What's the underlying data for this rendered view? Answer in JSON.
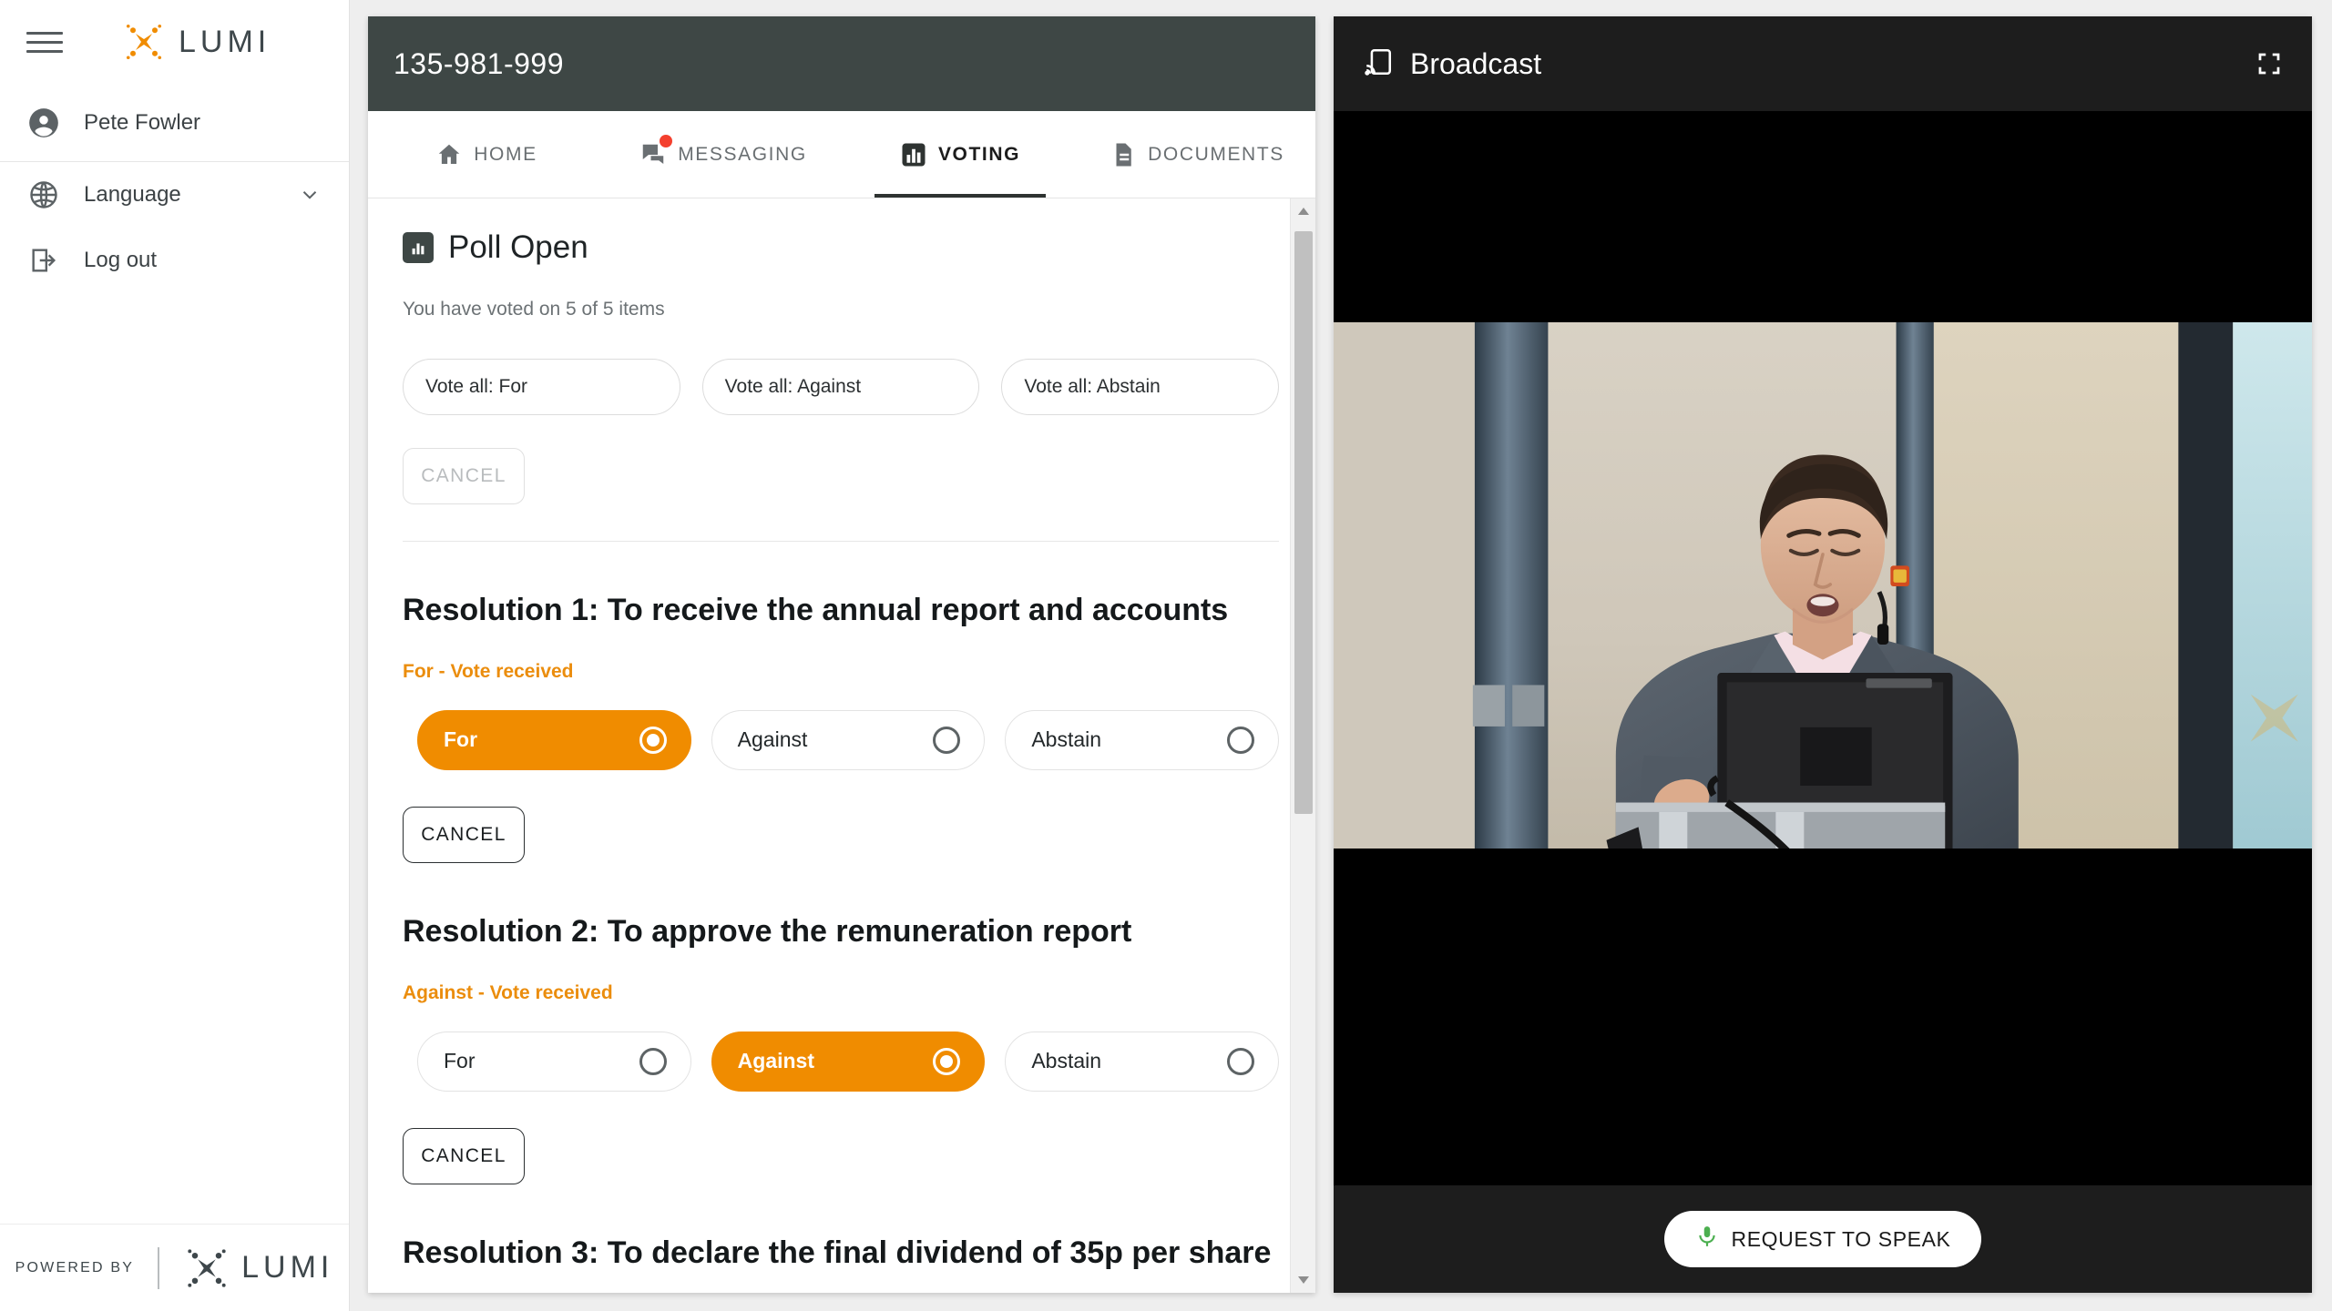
{
  "sidebar": {
    "menu_icon": "hamburger-icon",
    "brand": {
      "name": "LUMI",
      "mark": "lumi-x-icon",
      "accent": "#f08c00"
    },
    "user": {
      "icon": "account-circle-icon",
      "name": "Pete Fowler"
    },
    "items": [
      {
        "icon": "globe-icon",
        "label": "Language",
        "trailing_icon": "chevron-down-icon"
      },
      {
        "icon": "logout-icon",
        "label": "Log out",
        "trailing_icon": ""
      }
    ],
    "footer": {
      "powered_by": "POWERED BY",
      "brand": "LUMI"
    }
  },
  "meeting": {
    "header": {
      "code": "135-981-999",
      "bg": "#3e4745"
    },
    "tabs": [
      {
        "id": "home",
        "label": "HOME",
        "icon": "home-icon",
        "active": false,
        "badge": false
      },
      {
        "id": "messaging",
        "label": "MESSAGING",
        "icon": "chat-icon",
        "active": false,
        "badge": true
      },
      {
        "id": "voting",
        "label": "VOTING",
        "icon": "poll-bars-icon",
        "active": true,
        "badge": false
      },
      {
        "id": "documents",
        "label": "DOCUMENTS",
        "icon": "document-icon",
        "active": false,
        "badge": false
      }
    ],
    "poll": {
      "status_icon": "poll-bars-icon",
      "status_title": "Poll Open",
      "progress_text": "You have voted on 5 of 5 items",
      "vote_all_buttons": [
        "Vote all: For",
        "Vote all: Against",
        "Vote all: Abstain"
      ],
      "top_cancel_label": "CANCEL",
      "top_cancel_disabled": true
    },
    "resolutions": [
      {
        "title": "Resolution 1: To receive the annual report and accounts",
        "vote_status": "For - Vote received",
        "options": [
          {
            "label": "For",
            "selected": true
          },
          {
            "label": "Against",
            "selected": false
          },
          {
            "label": "Abstain",
            "selected": false
          }
        ],
        "cancel_label": "CANCEL"
      },
      {
        "title": "Resolution 2: To approve the remuneration report",
        "vote_status": "Against - Vote received",
        "options": [
          {
            "label": "For",
            "selected": false
          },
          {
            "label": "Against",
            "selected": true
          },
          {
            "label": "Abstain",
            "selected": false
          }
        ],
        "cancel_label": "CANCEL"
      },
      {
        "title": "Resolution 3: To declare the final dividend of 35p per share",
        "vote_status": "",
        "options": [],
        "cancel_label": ""
      }
    ],
    "scrollbar": {
      "up_arrow": "triangle-up-icon",
      "down_arrow": "triangle-down-icon"
    }
  },
  "broadcast": {
    "title": "Broadcast",
    "cast_icon": "cast-screen-icon",
    "fullscreen_icon": "fullscreen-icon",
    "video": {
      "description": "Man in grey suit jacket and pink shirt speaking at a lectern with a laptop",
      "letterbox_color": "#000000"
    },
    "request_to_speak": {
      "label": "REQUEST TO SPEAK",
      "icon": "microphone-icon",
      "icon_color": "#4caf50"
    }
  },
  "theme": {
    "accent_orange": "#f08c00",
    "header_dark": "#3e4745",
    "panel_dark": "#1d1d1d",
    "page_bg": "#eeeeee",
    "badge_red": "#f4402e"
  }
}
